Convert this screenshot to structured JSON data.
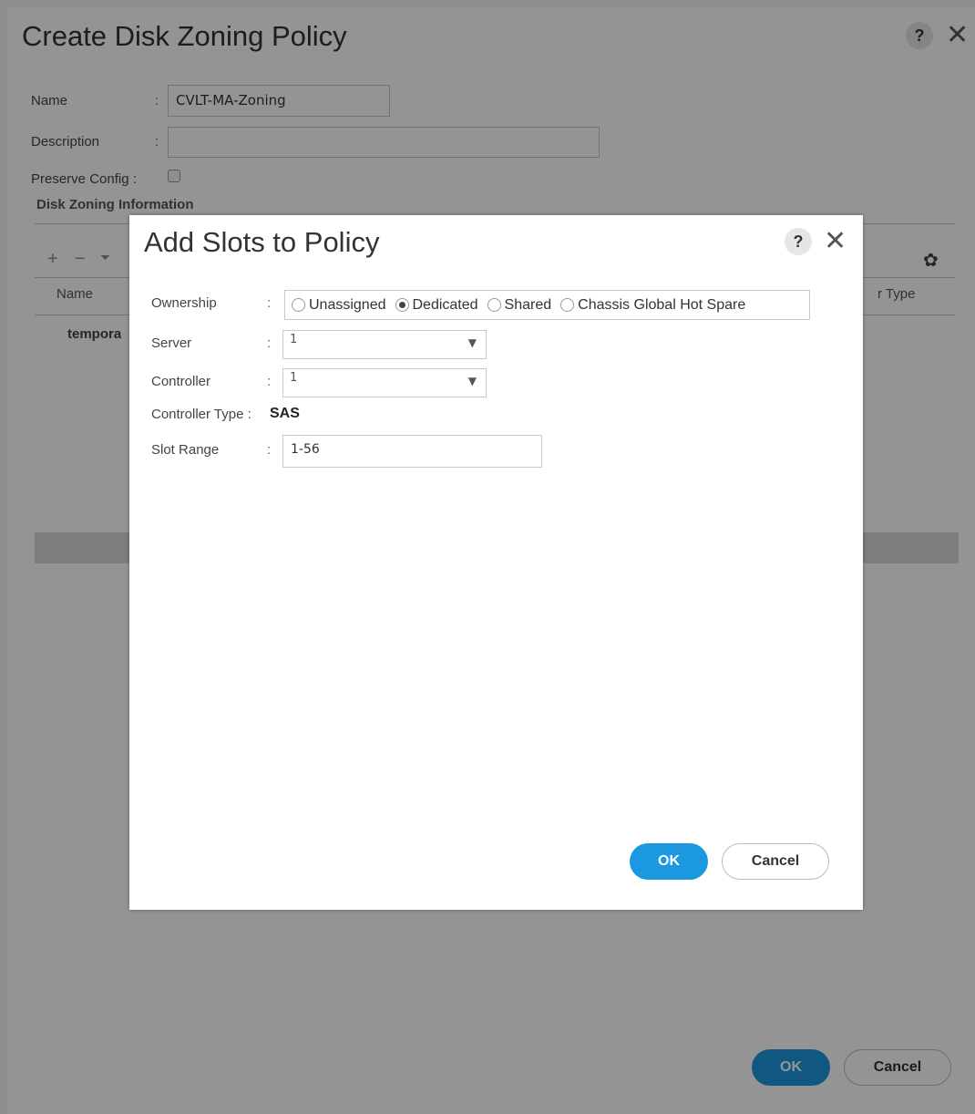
{
  "outer": {
    "title": "Create Disk Zoning Policy",
    "help_label": "?",
    "close_label": "✕",
    "name_label": "Name",
    "name_value": "CVLT-MA-Zoning",
    "description_label": "Description",
    "description_value": "",
    "preserve_label": "Preserve Config :",
    "preserve_checked": false,
    "section_title": "Disk Zoning Information",
    "toolbar": {
      "add": "+",
      "remove": "−",
      "filter": "⏷",
      "settings": "✿"
    },
    "table": {
      "col_name": "Name",
      "col_type_partial": "r Type",
      "row_name_partial": "tempora"
    },
    "ok_label": "OK",
    "cancel_label": "Cancel"
  },
  "modal": {
    "title": "Add Slots to Policy",
    "help_label": "?",
    "close_label": "✕",
    "ownership_label": "Ownership",
    "ownership_options": [
      "Unassigned",
      "Dedicated",
      "Shared",
      "Chassis Global Hot Spare"
    ],
    "ownership_selected": "Dedicated",
    "server_label": "Server",
    "server_value": "1",
    "controller_label": "Controller",
    "controller_value": "1",
    "controller_type_label": "Controller Type :",
    "controller_type_value": "SAS",
    "slot_range_label": "Slot Range",
    "slot_range_value": "1-56",
    "ok_label": "OK",
    "cancel_label": "Cancel"
  },
  "colors": {
    "accent": "#1c98e0",
    "overlay": "rgba(0,0,0,0.42)"
  }
}
